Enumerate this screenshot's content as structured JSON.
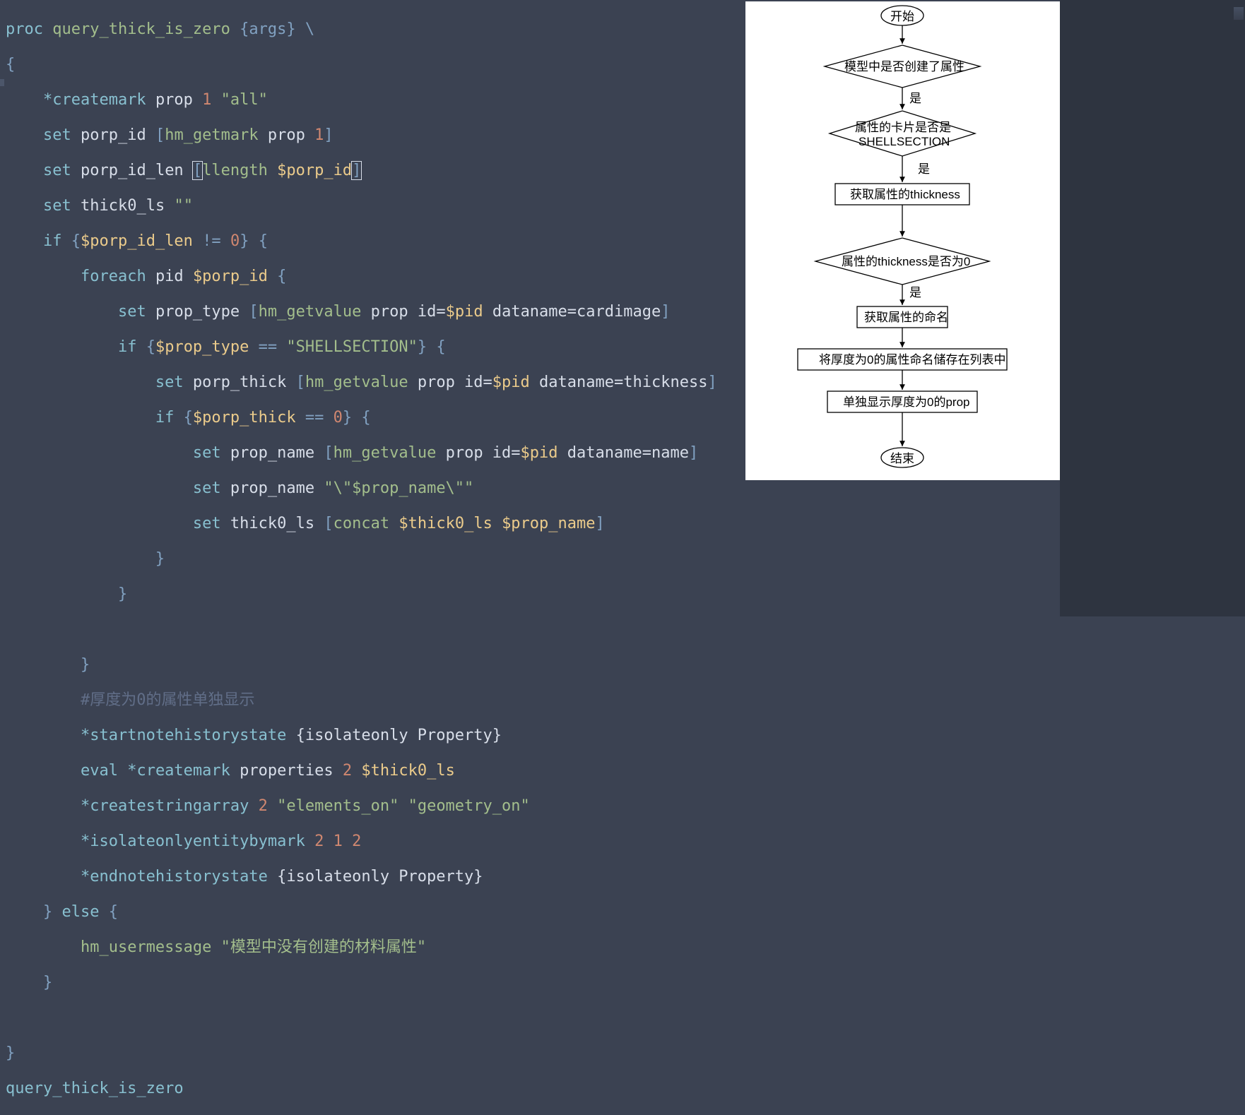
{
  "code": {
    "l1_proc": "proc",
    "l1_fn": "query_thick_is_zero",
    "l1_args": "{args}",
    "l1_back": "\\",
    "l2": "{",
    "l3_cmd": "*createmark",
    "l3_a": "prop",
    "l3_n": "1",
    "l3_s": "\"all\"",
    "l4_set": "set",
    "l4_v": "porp_id",
    "l4_fn": "hm_getmark",
    "l4_a": "prop",
    "l4_n": "1",
    "l5_set": "set",
    "l5_v": "porp_id_len",
    "l5_fn": "llength",
    "l5_p": "$porp_id",
    "l6_set": "set",
    "l6_v": "thick0_ls",
    "l6_s": "\"\"",
    "l7_if": "if",
    "l7_p": "$porp_id_len",
    "l7_op": "!=",
    "l7_n": "0",
    "l8_fe": "foreach",
    "l8_v": "pid",
    "l8_p": "$porp_id",
    "l9_set": "set",
    "l9_v": "prop_type",
    "l9_fn": "hm_getvalue",
    "l9_a": "prop id=",
    "l9_p": "$pid",
    "l9_b": "dataname=cardimage",
    "l10_if": "if",
    "l10_p": "$prop_type",
    "l10_op": "==",
    "l10_s": "\"SHELLSECTION\"",
    "l11_set": "set",
    "l11_v": "porp_thick",
    "l11_fn": "hm_getvalue",
    "l11_a": "prop id=",
    "l11_p": "$pid",
    "l11_b": "dataname=thickness",
    "l12_if": "if",
    "l12_p": "$porp_thick",
    "l12_op": "==",
    "l12_n": "0",
    "l13_set": "set",
    "l13_v": "prop_name",
    "l13_fn": "hm_getvalue",
    "l13_a": "prop id=",
    "l13_p": "$pid",
    "l13_b": "dataname=name",
    "l14_set": "set",
    "l14_v": "prop_name",
    "l14_s": "\"\\\"$prop_name\\\"\"",
    "l15_set": "set",
    "l15_v": "thick0_ls",
    "l15_fn": "concat",
    "l15_p1": "$thick0_ls",
    "l15_p2": "$prop_name",
    "l16": "}",
    "l17": "}",
    "l19": "}",
    "l20_cmt": "#厚度为0的属性单独显示",
    "l21_cmd": "*startnotehistorystate",
    "l21_a": "{isolateonly Property}",
    "l22_ev": "eval",
    "l22_cmd": "*createmark",
    "l22_a": "properties",
    "l22_n": "2",
    "l22_p": "$thick0_ls",
    "l23_cmd": "*createstringarray",
    "l23_n": "2",
    "l23_s1": "\"elements_on\"",
    "l23_s2": "\"geometry_on\"",
    "l24_cmd": "*isolateonlyentitybymark",
    "l24_n1": "2",
    "l24_n2": "1",
    "l24_n3": "2",
    "l25_cmd": "*endnotehistorystate",
    "l25_a": "{isolateonly Property}",
    "l26_else": "else",
    "l27_fn": "hm_usermessage",
    "l27_s": "\"模型中没有创建的材料属性\"",
    "l28": "}",
    "l30": "}",
    "l31": "query_thick_is_zero"
  },
  "flow": {
    "start": "开始",
    "d1": "模型中是否创建了属性",
    "yes1": "是",
    "d2a": "属性的卡片是否是",
    "d2b": "SHELLSECTION",
    "yes2": "是",
    "r1": "获取属性的thickness",
    "d3": "属性的thickness是否为0",
    "yes3": "是",
    "r2": "获取属性的命名",
    "r3": "将厚度为0的属性命名储存在列表中",
    "r4": "单独显示厚度为0的prop",
    "end": "结束"
  }
}
